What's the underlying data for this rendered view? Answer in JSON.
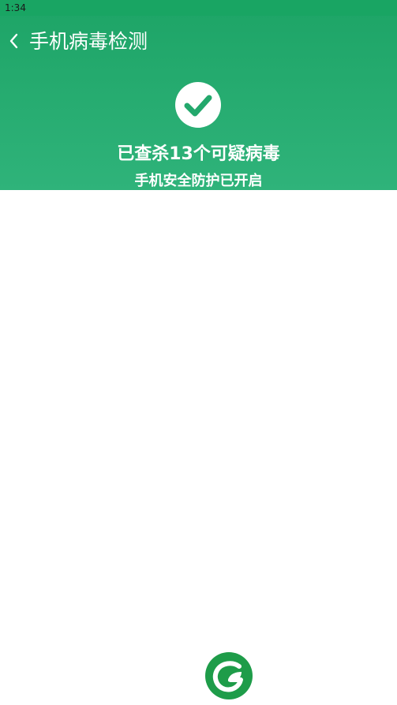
{
  "status_bar": {
    "time": "1:34"
  },
  "toolbar": {
    "title": "手机病毒检测",
    "back_icon": "chevron-left-icon"
  },
  "result": {
    "icon": "check-circle-icon",
    "title": "已查杀13个可疑病毒",
    "subtitle": "手机安全防护已开启"
  },
  "footer": {
    "logo_icon": "leaf-logo-icon"
  },
  "colors": {
    "header_top": "#1da466",
    "header_bottom": "#2fb37a",
    "logo_green": "#1e9c49",
    "white": "#ffffff"
  }
}
